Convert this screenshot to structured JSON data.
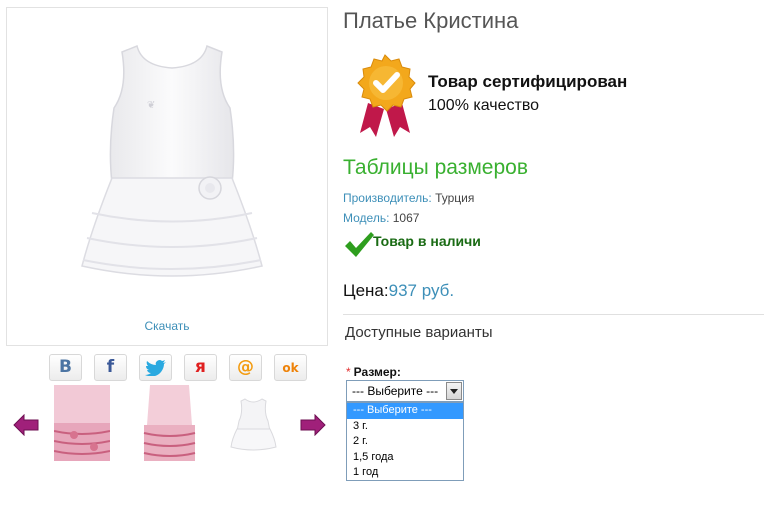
{
  "product": {
    "title": "Платье Кристина",
    "download_label": "Скачать"
  },
  "certificate": {
    "title": "Товар сертифицирован",
    "subtitle": "100% качество"
  },
  "size_table_link": "Таблицы размеров",
  "meta": {
    "manufacturer_label": "Производитель:",
    "manufacturer_value": "Турция",
    "model_label": "Модель:",
    "model_value": "1067"
  },
  "stock": {
    "text": "Товар в наличи"
  },
  "price": {
    "label": "Цена:",
    "value": "937 руб."
  },
  "variants": {
    "title": "Доступные варианты",
    "size_label": "Размер:",
    "required_mark": "*",
    "selected": "--- Выберите ---",
    "options": [
      "--- Выберите ---",
      "3 г.",
      "2 г.",
      "1,5 года",
      "1 год"
    ]
  },
  "social": [
    {
      "glyph": "В",
      "icon": "vk-icon",
      "color": "#4c75a3"
    },
    {
      "glyph": "f",
      "icon": "facebook-icon",
      "color": "#3b5998"
    },
    {
      "glyph": "",
      "icon": "twitter-icon",
      "color": "#2aa9e0"
    },
    {
      "glyph": "я",
      "icon": "yaru-icon",
      "color": "#e02020"
    },
    {
      "glyph": "@",
      "icon": "mailru-icon",
      "color": "#f39c12"
    },
    {
      "glyph": "ok",
      "icon": "odnoklassniki-icon",
      "color": "#ee8208"
    }
  ],
  "colors": {
    "accent_green": "#39b030",
    "link_blue": "#3d8fb8",
    "arrow_purple": "#a0207a",
    "stock_green": "#1a6b14"
  }
}
